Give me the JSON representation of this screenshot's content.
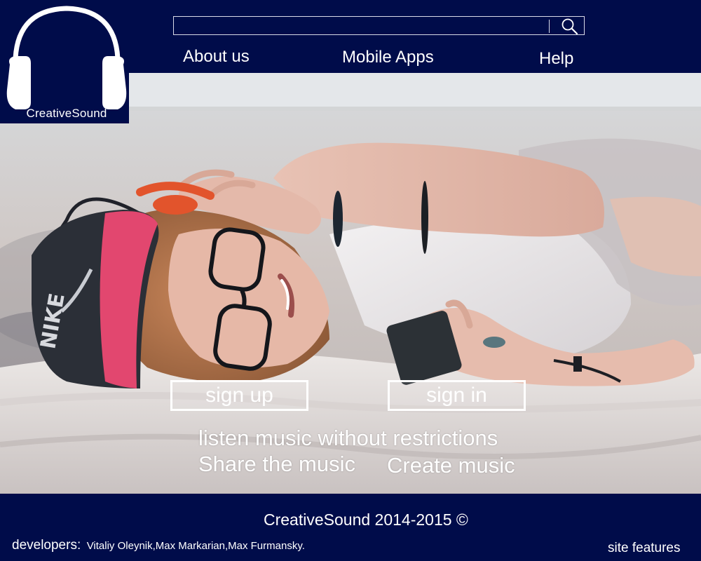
{
  "brand": {
    "name": "CreativeSound",
    "logo_icon": "headphones-icon"
  },
  "header": {
    "search": {
      "value": "",
      "placeholder": "",
      "icon": "search-icon"
    },
    "nav": [
      {
        "label": "About us"
      },
      {
        "label": "Mobile Apps"
      },
      {
        "label": "Help"
      }
    ]
  },
  "hero": {
    "image": "hero-photo",
    "signup_label": "sign up",
    "signin_label": "sign in",
    "tagline_main": "listen  music without restrictions",
    "tagline_share": "Share the music",
    "tagline_create": "Create music"
  },
  "footer": {
    "copyright": "CreativeSound 2014-2015 ©",
    "developers_label": "developers:",
    "developers_names": "Vitaliy Oleynik,Max Markarian,Max Furmansky.",
    "site_features": "site features"
  },
  "colors": {
    "navy": "#000c4a",
    "white": "#ffffff",
    "cap_pink": "#e2476f",
    "headphone_orange": "#e2542c"
  }
}
